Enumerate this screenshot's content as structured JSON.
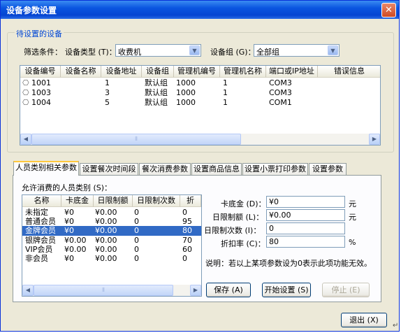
{
  "window": {
    "title": "设备参数设置",
    "close_glyph": "✕"
  },
  "devices_group": {
    "legend": "待设置的设备",
    "filter_label": "筛选条件：",
    "device_type_label": "设备类型 (T)：",
    "device_type_value": "收费机",
    "device_group_label": "设备组 (G)：",
    "device_group_value": "全部组",
    "columns": [
      "设备编号",
      "设备名称",
      "设备地址",
      "设备组",
      "管理机编号",
      "管理机名称",
      "端口或IP地址",
      "错误信息"
    ],
    "rows": [
      [
        "1001",
        "",
        "1",
        "默认组",
        "1000",
        "1",
        "COM3",
        ""
      ],
      [
        "1003",
        "",
        "3",
        "默认组",
        "1000",
        "1",
        "COM3",
        ""
      ],
      [
        "1004",
        "",
        "5",
        "默认组",
        "1000",
        "1",
        "COM1",
        ""
      ]
    ]
  },
  "tabs": [
    "人员类别相关参数",
    "设置餐次时间段",
    "餐次消费参数",
    "设置商品信息",
    "设置小票打印参数",
    "设置参数"
  ],
  "tab_panel": {
    "list_label": "允许消费的人员类别 (S)：",
    "columns": [
      "名称",
      "卡底金",
      "日限制额",
      "日限制次数",
      "折"
    ],
    "rows": [
      [
        "未指定",
        "¥0",
        "¥0.00",
        "0",
        "0"
      ],
      [
        "普通会员",
        "¥0",
        "¥0.00",
        "0",
        "95"
      ],
      [
        "金牌会员",
        "¥0",
        "¥0.00",
        "0",
        "80"
      ],
      [
        "银牌会员",
        "¥0.00",
        "¥0.00",
        "0",
        "70"
      ],
      [
        "VIP会员",
        "¥0.00",
        "¥0.00",
        "0",
        "60"
      ],
      [
        "非会员",
        "¥0",
        "¥0.00",
        "0",
        "0"
      ]
    ],
    "selected_row_index": 2,
    "fields": {
      "card_base_label": "卡底金 (D)：",
      "card_base_value": "¥0",
      "card_base_unit": "元",
      "daily_limit_label": "日限制额 (L)：",
      "daily_limit_value": "¥0.00",
      "daily_limit_unit": "元",
      "daily_count_label": "日限制次数 (I)：",
      "daily_count_value": "0",
      "discount_label": "折扣率 (C)：",
      "discount_value": "80",
      "discount_unit": "%"
    },
    "note": "说明：若以上某项参数设为0表示此项功能无效。",
    "save_button": "保存 (A)",
    "start_button": "开始设置 (S)",
    "stop_button": "停止 (E)"
  },
  "exit_button": "退出 (X)",
  "corner_mark": "↵"
}
